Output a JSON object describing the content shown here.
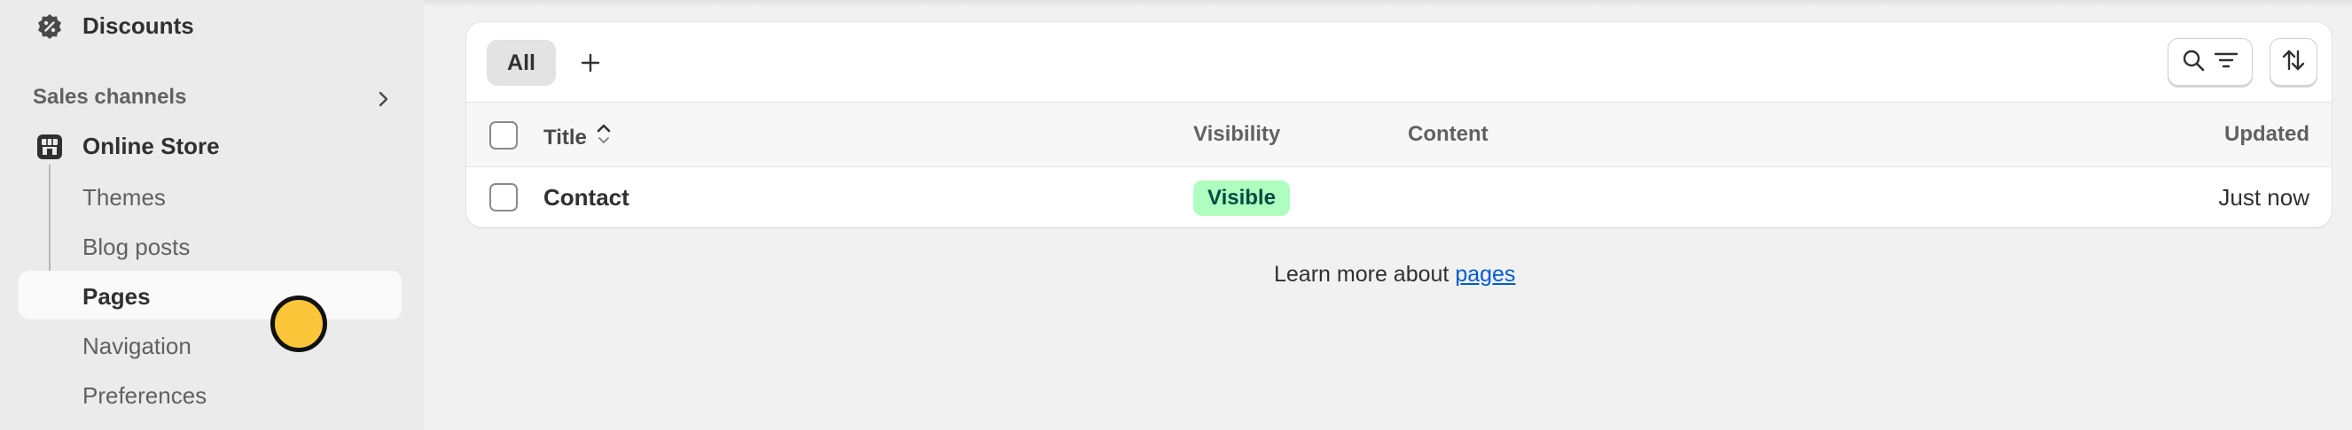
{
  "sidebar": {
    "discounts_label": "Discounts",
    "section_header": "Sales channels",
    "online_store_label": "Online Store",
    "items": [
      {
        "label": "Themes"
      },
      {
        "label": "Blog posts"
      },
      {
        "label": "Pages"
      },
      {
        "label": "Navigation"
      },
      {
        "label": "Preferences"
      }
    ],
    "active_item": "Pages"
  },
  "toolbar": {
    "tab_all": "All",
    "add_icon": "plus-icon",
    "search_icon": "search-icon",
    "filter_icon": "filter-icon",
    "sort_icon": "sort-icon"
  },
  "table": {
    "columns": {
      "title": "Title",
      "visibility": "Visibility",
      "content": "Content",
      "updated": "Updated"
    },
    "rows": [
      {
        "title": "Contact",
        "visibility": "Visible",
        "content": "",
        "updated": "Just now"
      }
    ]
  },
  "footer": {
    "learn_more_text": "Learn more about",
    "link_text": "pages"
  },
  "colors": {
    "badge_bg": "#affebf",
    "badge_text": "#014b40",
    "link": "#005bd3",
    "cursor": "#fcc63a"
  }
}
